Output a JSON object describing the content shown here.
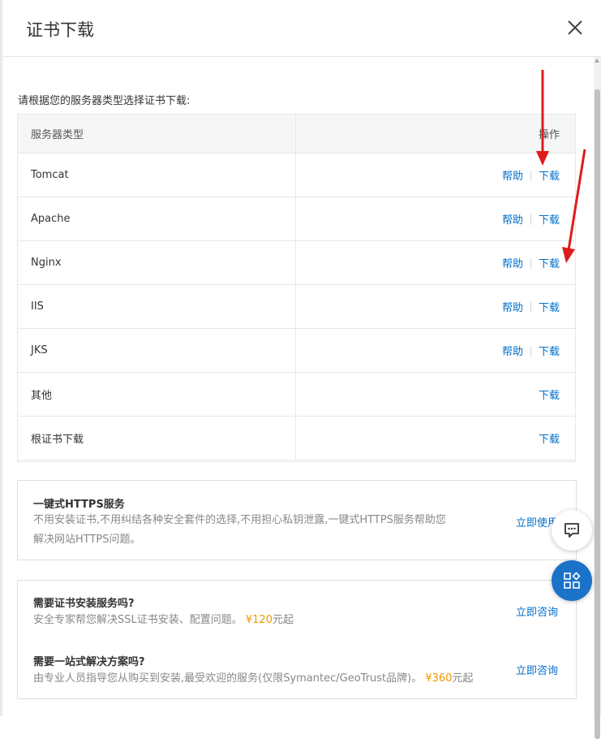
{
  "dialog": {
    "title": "证书下载",
    "close_icon": "close-icon"
  },
  "intro_text": "请根据您的服务器类型选择证书下载:",
  "table": {
    "headers": [
      "服务器类型",
      "操作"
    ],
    "help_label": "帮助",
    "download_label": "下载",
    "rows": [
      {
        "server": "Tomcat",
        "help": true
      },
      {
        "server": "Apache",
        "help": true
      },
      {
        "server": "Nginx",
        "help": true
      },
      {
        "server": "IIS",
        "help": true
      },
      {
        "server": "JKS",
        "help": true
      },
      {
        "server": "其他",
        "help": false
      },
      {
        "server": "根证书下载",
        "help": false
      }
    ]
  },
  "https_service": {
    "title": "一键式HTTPS服务",
    "line1": "不用安装证书,不用纠结各种安全套件的选择,不用担心私钥泄露,一键式HTTPS服务帮助您",
    "line2": "解决网站HTTPS问题。",
    "action": "立即使用"
  },
  "install_service": {
    "title": "需要证书安装服务吗?",
    "desc": "安全专家帮您解决SSL证书安装、配置问题。",
    "price": "¥120",
    "price_suffix": "元起",
    "action": "立即咨询"
  },
  "solution_service": {
    "title": "需要一站式解决方案吗?",
    "desc": "由专业人员指导您从购买到安装,最受欢迎的服务(仅限Symantec/GeoTrust品牌)。",
    "price": "¥360",
    "price_suffix": "元起",
    "action": "立即咨询"
  },
  "floating_buttons": {
    "chat_icon": "chat-icon",
    "apps_icon": "apps-icon"
  },
  "colors": {
    "link": "#0070cc",
    "price": "#f39800",
    "annotation_arrow": "#e01b1b",
    "fab_blue": "#1a72c9"
  }
}
